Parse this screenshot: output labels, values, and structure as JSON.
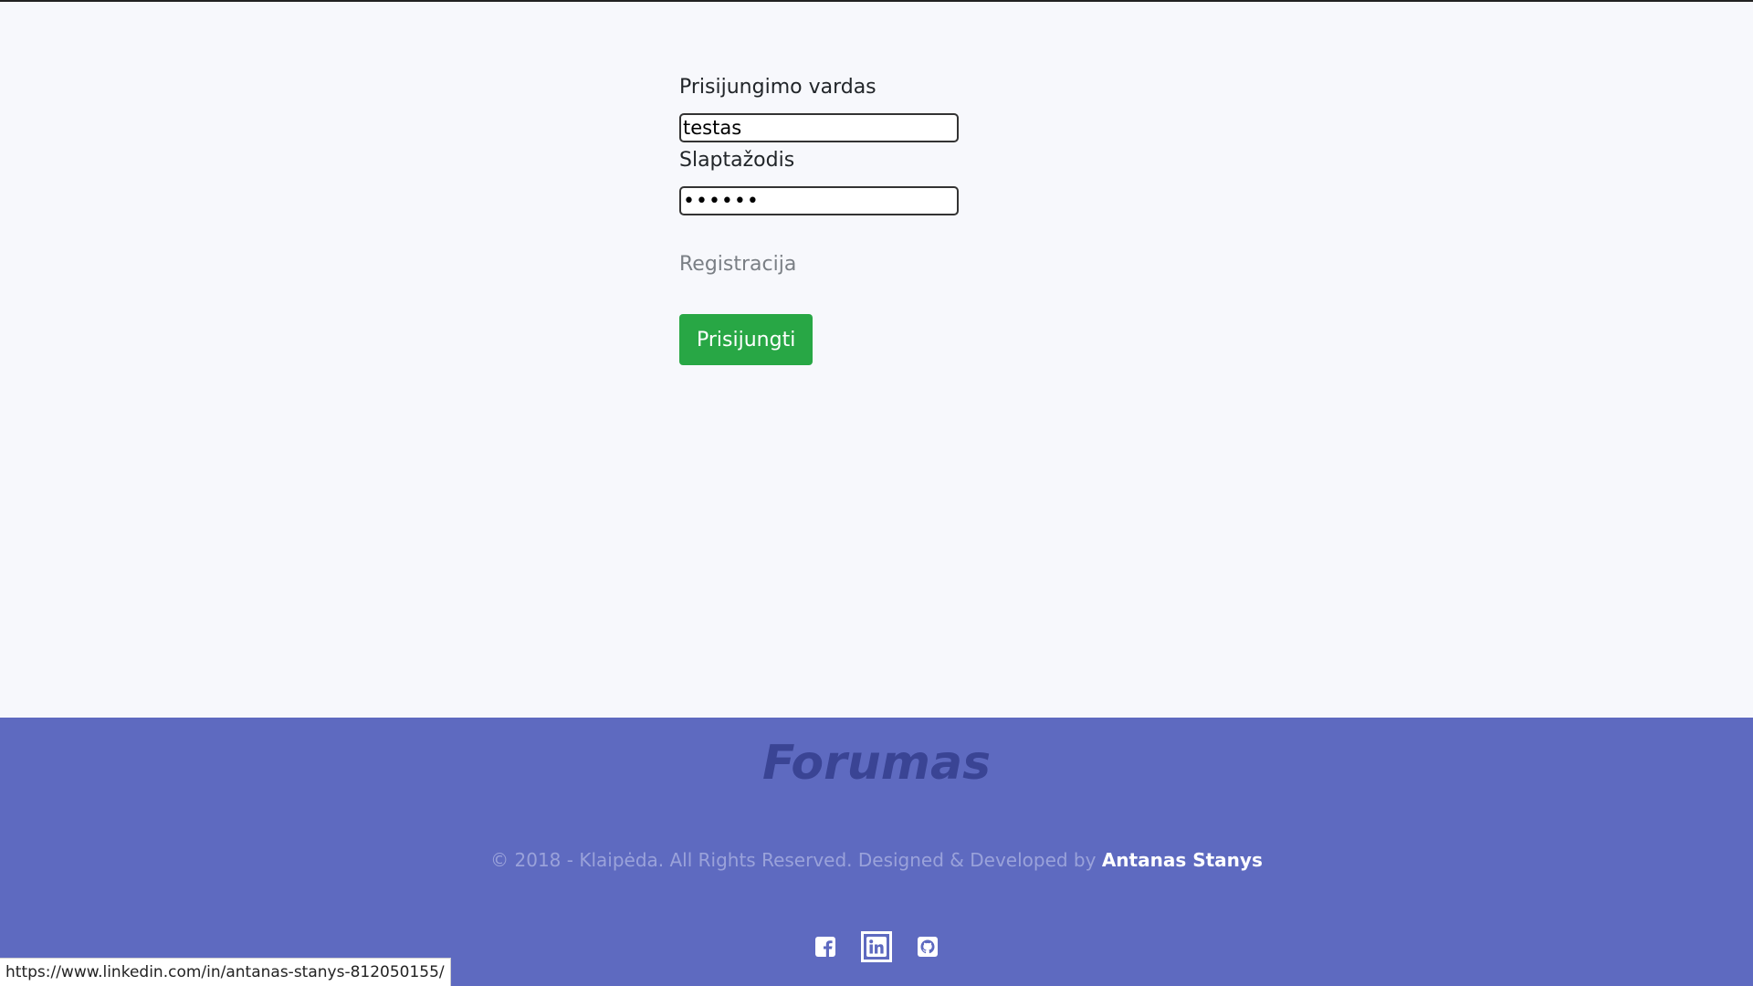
{
  "login": {
    "username_label": "Prisijungimo vardas",
    "username_value": "testas",
    "password_label": "Slaptažodis",
    "password_value": "••••••",
    "register_link": "Registracija",
    "submit_label": "Prisijungti"
  },
  "footer": {
    "brand": "Forumas",
    "copyright": "© 2018 - Klaipėda. All Rights Reserved. Designed & Developed by",
    "author": "Antanas Stanys",
    "social": [
      {
        "icon": "facebook-icon"
      },
      {
        "icon": "linkedin-icon"
      },
      {
        "icon": "github-icon"
      }
    ]
  },
  "status_bar": {
    "url": "https://www.linkedin.com/in/antanas-stanys-812050155/"
  },
  "colors": {
    "background": "#f7f8fc",
    "footer": "#5e6ac0",
    "button": "#28a745",
    "brand": "#3a4494"
  }
}
